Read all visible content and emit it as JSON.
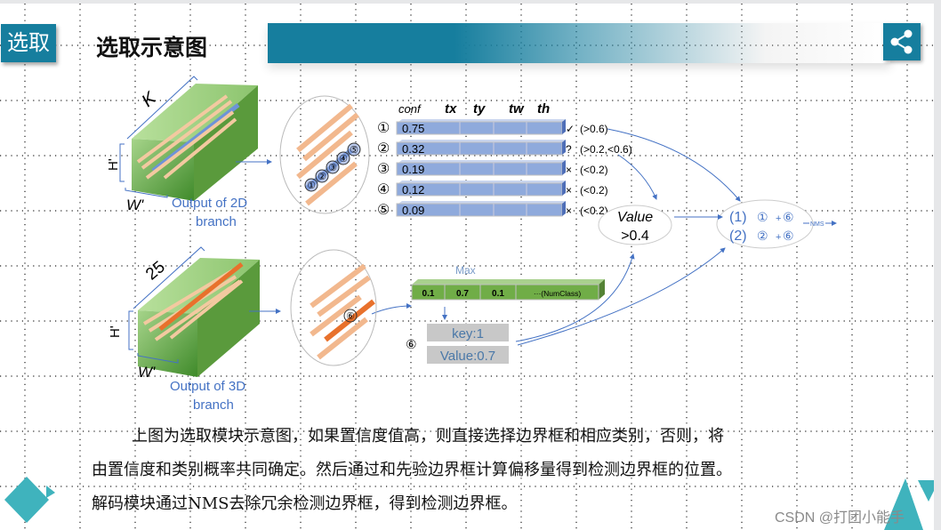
{
  "slide": {
    "section_tag": "选取",
    "title": "选取示意图",
    "share_icon": "share-icon",
    "accent_color": "#167e9e",
    "corner_color": "#3fb3bd"
  },
  "diagram": {
    "top_cube": {
      "depth_label": "K",
      "height_label": "H'",
      "width_label": "W'",
      "caption_line1": "Output of 2D",
      "caption_line2": "branch"
    },
    "bottom_cube": {
      "depth_label": "25",
      "height_label": "H'",
      "width_label": "W'",
      "caption_line1": "Output of 3D",
      "caption_line2": "branch"
    },
    "box_headers": [
      "conf",
      "tx",
      "ty",
      "tw",
      "th"
    ],
    "boxes": [
      {
        "index": "①",
        "conf": "0.75",
        "mark": "✓",
        "range": "(>0.6)"
      },
      {
        "index": "②",
        "conf": "0.32",
        "mark": "?",
        "range": "(>0.2,<0.6)"
      },
      {
        "index": "③",
        "conf": "0.19",
        "mark": "×",
        "range": "(<0.2)"
      },
      {
        "index": "④",
        "conf": "0.12",
        "mark": "×",
        "range": "(<0.2)"
      },
      {
        "index": "⑤",
        "conf": "0.09",
        "mark": "×",
        "range": "(<0.2)"
      }
    ],
    "anchor_labels": [
      "①",
      "②",
      "③",
      "④",
      "⑤"
    ],
    "class_anchor_label": "⑥",
    "max_label": "Max",
    "class_probs": [
      "0.1",
      "0.7",
      "0.1",
      "···(NumClass)"
    ],
    "class_index": "⑥",
    "key_label": "key:1",
    "value_label": "Value:0.7",
    "value_ellipse": {
      "line1": "Value",
      "line2": ">0.4"
    },
    "result": {
      "row1": {
        "label": "(1)",
        "a": "①",
        "plus": "+",
        "b": "⑥"
      },
      "row2": {
        "label": "(2)",
        "a": "②",
        "plus": "+",
        "b": "⑥"
      }
    },
    "nms_label": "NMS"
  },
  "paragraph": [
    "上图为选取模块示意图，如果置信度值高，则直接选择边界框和相应类别，否则，将",
    "由置信度和类别概率共同确定。然后通过和先验边界框计算偏移量得到检测边界框的位置。",
    "解码模块通过NMS去除冗余检测边界框，得到检测边界框。"
  ],
  "watermark": "CSDN @打团小能手"
}
